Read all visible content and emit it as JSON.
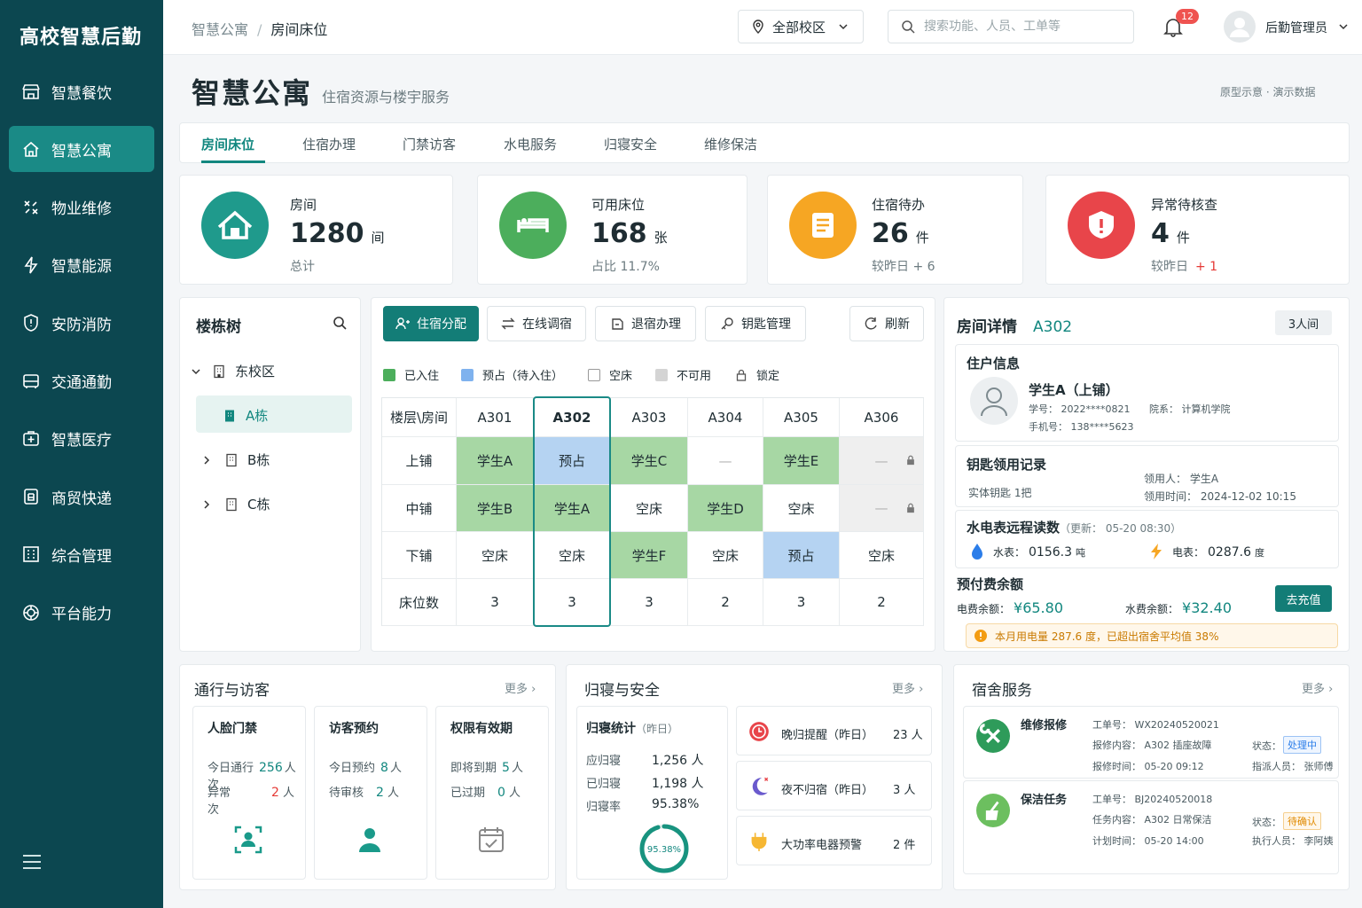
{
  "app": {
    "logo": "高校智慧后勤"
  },
  "sidebar": {
    "items": [
      {
        "label": "智慧餐饮",
        "icon": "shop-icon"
      },
      {
        "label": "智慧公寓",
        "icon": "home-icon"
      },
      {
        "label": "物业维修",
        "icon": "tools-icon"
      },
      {
        "label": "智慧能源",
        "icon": "lightning-icon"
      },
      {
        "label": "安防消防",
        "icon": "shield-icon"
      },
      {
        "label": "交通通勤",
        "icon": "bus-icon"
      },
      {
        "label": "智慧医疗",
        "icon": "medical-icon"
      },
      {
        "label": "商贸快递",
        "icon": "package-icon"
      },
      {
        "label": "综合管理",
        "icon": "building-icon"
      },
      {
        "label": "平台能力",
        "icon": "platform-icon"
      }
    ]
  },
  "topbar": {
    "breadcrumb": [
      "智慧公寓",
      "房间床位"
    ],
    "campus": "全部校区",
    "search_placeholder": "搜索功能、人员、工单等",
    "notifications": "12",
    "user": "后勤管理员"
  },
  "page": {
    "title": "智慧公寓",
    "subtitle": "住宿资源与楼宇服务",
    "note": "原型示意 · 演示数据"
  },
  "tabs": [
    "房间床位",
    "住宿办理",
    "门禁访客",
    "水电服务",
    "归寝安全",
    "维修保洁"
  ],
  "stats": [
    {
      "label": "房间",
      "value": "1280",
      "unit": "间",
      "sub": "总计",
      "color": "#1f9a8c"
    },
    {
      "label": "可用床位",
      "value": "168",
      "unit": "张",
      "sub": "占比  11.7%",
      "color": "#4cae5c"
    },
    {
      "label": "住宿待办",
      "value": "26",
      "unit": "件",
      "sub": "较昨日  + 6",
      "color": "#f6a623"
    },
    {
      "label": "异常待核查",
      "value": "4",
      "unit": "件",
      "sub_prefix": "较昨日",
      "sub_delta": "+ 1",
      "color": "#e8454a"
    }
  ],
  "tree": {
    "title": "楼栋树",
    "root": "东校区",
    "nodes": [
      "A栋",
      "B栋",
      "C栋"
    ]
  },
  "actions": [
    "住宿分配",
    "在线调宿",
    "退宿办理",
    "钥匙管理",
    "刷新"
  ],
  "legend": [
    "已入住",
    "预占（待入住）",
    "空床",
    "不可用",
    "锁定"
  ],
  "grid": {
    "corner": "楼层\\房间",
    "rooms": [
      "A301",
      "A302",
      "A303",
      "A304",
      "A305",
      "A306"
    ],
    "rows": [
      {
        "label": "上铺",
        "cells": [
          [
            "学生A",
            "occ"
          ],
          [
            "预占",
            "res"
          ],
          [
            "学生C",
            "occ"
          ],
          [
            "—",
            "empty"
          ],
          [
            "学生E",
            "occ"
          ],
          [
            "—",
            "na"
          ]
        ]
      },
      {
        "label": "中铺",
        "cells": [
          [
            "学生B",
            "occ"
          ],
          [
            "学生A",
            "occ"
          ],
          [
            "空床",
            "empty"
          ],
          [
            "学生D",
            "occ"
          ],
          [
            "空床",
            "empty"
          ],
          [
            "—",
            "na"
          ]
        ]
      },
      {
        "label": "下铺",
        "cells": [
          [
            "空床",
            "empty"
          ],
          [
            "空床",
            "empty"
          ],
          [
            "学生F",
            "occ"
          ],
          [
            "空床",
            "empty"
          ],
          [
            "预占",
            "res"
          ],
          [
            "空床",
            "empty"
          ]
        ]
      }
    ],
    "count_label": "床位数",
    "counts": [
      "3",
      "3",
      "3",
      "2",
      "3",
      "2"
    ]
  },
  "detail": {
    "title": "房间详情",
    "room": "A302",
    "type": "3人间",
    "resident_title": "住户信息",
    "resident_name": "学生A（上铺）",
    "student_id": "学号： 2022****0821",
    "college": "院系： 计算机学院",
    "phone": "手机号： 138****5623",
    "key_title": "钥匙领用记录",
    "key_count": "实体钥匙  1把",
    "key_user": "领用人： 学生A",
    "key_time": "领用时间： 2024-12-02 10:15",
    "meter_title": "水电表远程读数",
    "meter_update": "（更新： 05-20 08:30）",
    "water_label": "水表：",
    "water_val": "0156.3",
    "water_unit": "吨",
    "elec_label": "电表：",
    "elec_val": "0287.6",
    "elec_unit": "度",
    "balance_title": "预付费余额",
    "elec_balance_label": "电费余额：",
    "elec_balance": "¥65.80",
    "water_balance_label": "水费余额：",
    "water_balance": "¥32.40",
    "recharge": "去充值",
    "alert": "本月用电量 287.6 度，已超出宿舍平均值 38%"
  },
  "access": {
    "title": "通行与访客",
    "more": "更多",
    "cards": [
      {
        "title": "人脸门禁",
        "r1": "今日通行",
        "v1": "256",
        "u1": "人次",
        "r2": "异常",
        "v2": "2",
        "u2": "人次",
        "icon": "face-scan-icon"
      },
      {
        "title": "访客预约",
        "r1": "今日预约",
        "v1": "8",
        "u1": "人",
        "r2": "待审核",
        "v2": "2",
        "u2": "人",
        "icon": "person-icon"
      },
      {
        "title": "权限有效期",
        "r1": "即将到期",
        "v1": "5",
        "u1": "人",
        "r2": "已过期",
        "v2": "0",
        "u2": "人",
        "icon": "calendar-icon"
      }
    ]
  },
  "safety": {
    "title": "归寝与安全",
    "more": "更多",
    "stat_title": "归寝统计",
    "stat_sub": "（昨日）",
    "rows": [
      [
        "应归寝",
        "1,256 人"
      ],
      [
        "已归寝",
        "1,198 人"
      ],
      [
        "归寝率",
        "95.38%"
      ]
    ],
    "ring": 0.9538,
    "ring_label": "95.38%",
    "alerts": [
      {
        "label": "晚归提醒（昨日）",
        "value": "23 人",
        "icon": "clock-icon"
      },
      {
        "label": "夜不归宿（昨日）",
        "value": "3 人",
        "icon": "moon-icon"
      },
      {
        "label": "大功率电器预警",
        "value": "2 件",
        "icon": "plug-icon"
      }
    ]
  },
  "service": {
    "title": "宿舍服务",
    "more": "更多",
    "items": [
      {
        "name": "维修报修",
        "no": "工单号： WX20240520021",
        "content": "报修内容： A302 插座故障",
        "time": "报修时间： 05-20 09:12",
        "status_label": "状态：",
        "status": "处理中",
        "person": "指派人员： 张师傅",
        "icon": "wrench-icon",
        "color": "#2e9b5a"
      },
      {
        "name": "保洁任务",
        "no": "工单号： BJ20240520018",
        "content": "任务内容： A302 日常保洁",
        "time": "计划时间： 05-20 14:00",
        "status_label": "状态：",
        "status": "待确认",
        "person": "执行人员： 李阿姨",
        "icon": "broom-icon",
        "color": "#6cbf5f"
      }
    ]
  }
}
